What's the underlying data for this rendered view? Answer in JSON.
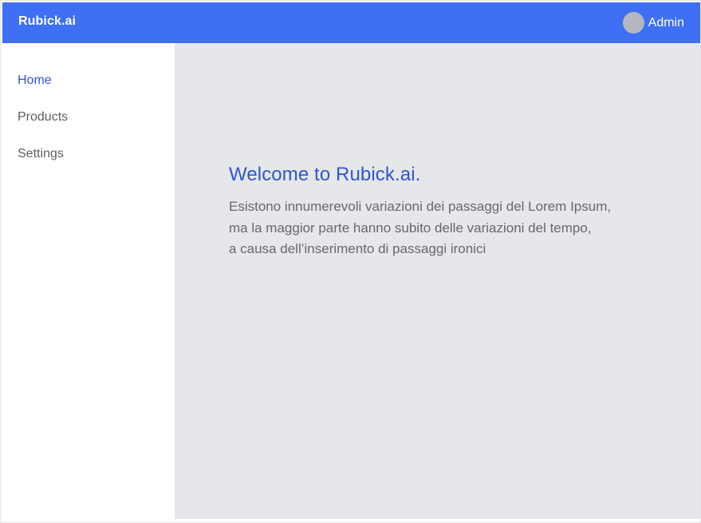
{
  "header": {
    "brand": "Rubick.ai",
    "user_name": "Admin"
  },
  "sidebar": {
    "items": [
      {
        "label": "Home",
        "active": true
      },
      {
        "label": "Products",
        "active": false
      },
      {
        "label": "Settings",
        "active": false
      }
    ]
  },
  "main": {
    "title": "Welcome to Rubick.ai.",
    "description_lines": [
      "Esistono innumerevoli variazioni dei passaggi del Lorem Ipsum,",
      "ma la maggior parte hanno subito delle variazioni del tempo,",
      "a causa dell’inserimento di passaggi ironici"
    ]
  },
  "colors": {
    "header_background": "#3f6ff4",
    "active_nav": "#2f55d4",
    "main_background": "#e6e7ea"
  },
  "icons": {
    "user_avatar": "avatar-placeholder"
  }
}
